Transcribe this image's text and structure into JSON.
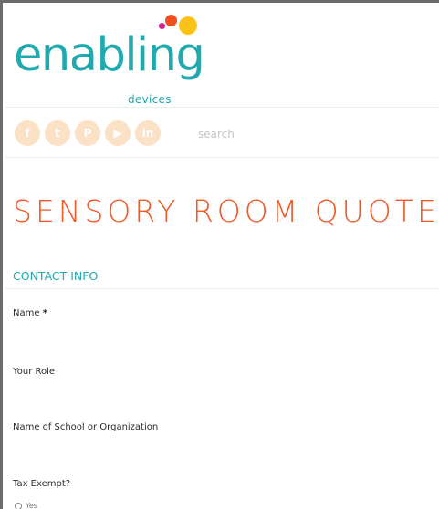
{
  "logo": {
    "word": "enabling",
    "sub": "devices"
  },
  "social": [
    {
      "name": "facebook",
      "glyph": "f"
    },
    {
      "name": "twitter",
      "glyph": "t"
    },
    {
      "name": "pinterest",
      "glyph": "P"
    },
    {
      "name": "youtube",
      "glyph": "▶"
    },
    {
      "name": "linkedin",
      "glyph": "in"
    }
  ],
  "search": {
    "placeholder": "search"
  },
  "page": {
    "title": "SENSORY ROOM QUOTE"
  },
  "form": {
    "section_heading": "CONTACT INFO",
    "name_label": "Name",
    "required_mark": "*",
    "role_label": "Your Role",
    "school_label": "Name of School or Organization",
    "tax_label": "Tax Exempt?",
    "tax_option_yes": "Yes"
  },
  "colors": {
    "brand_teal": "#1faab0",
    "title_orange": "#ef5a26",
    "social_bg": "#fbe1c6"
  }
}
